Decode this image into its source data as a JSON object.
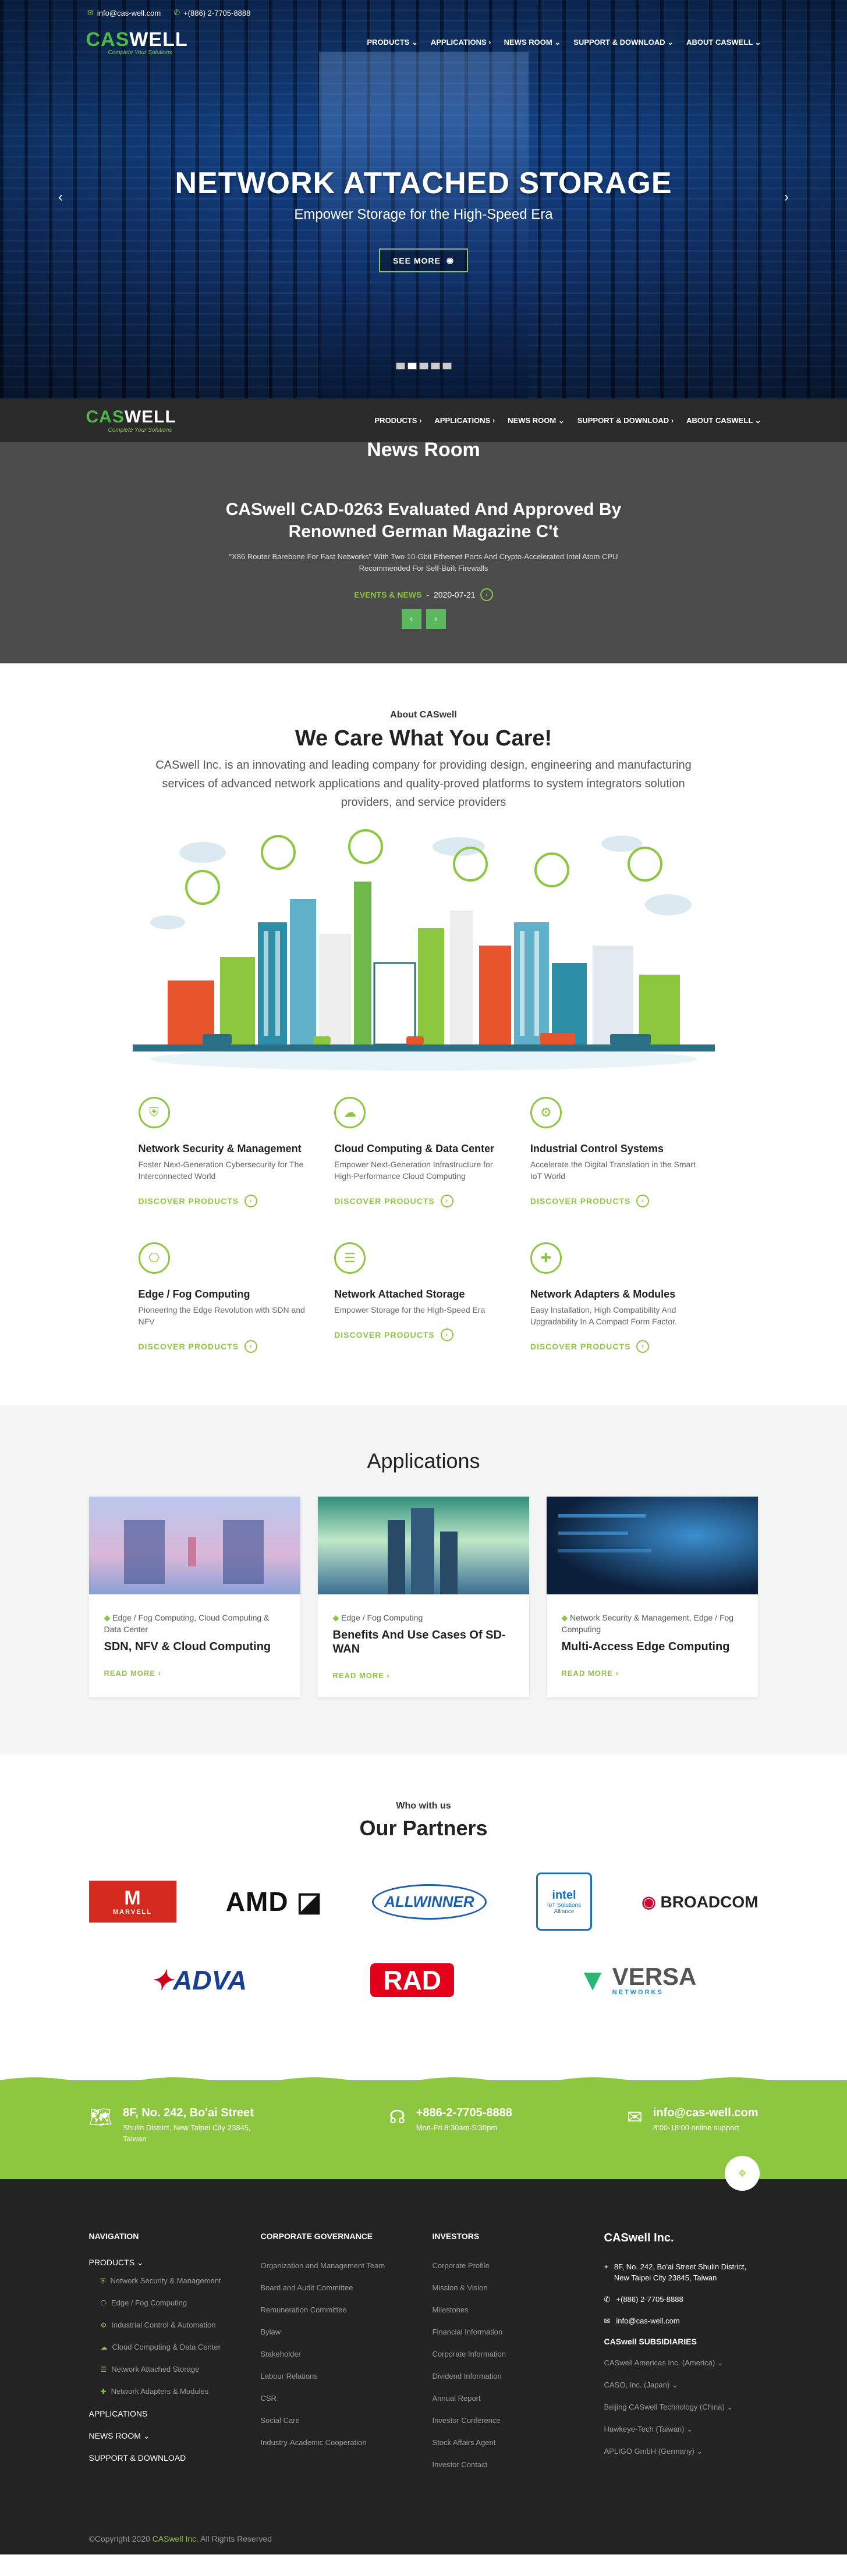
{
  "topbar": {
    "email": "info@cas-well.com",
    "phone": "+(886) 2-7705-8888"
  },
  "logo": {
    "text_a": "CAS",
    "text_b": "WELL",
    "slogan": "Complete Your Solutions"
  },
  "menu": [
    "PRODUCTS ⌄",
    "APPLICATIONS ›",
    "NEWS ROOM ⌄",
    "SUPPORT & DOWNLOAD ⌄",
    "ABOUT CASWELL ⌄"
  ],
  "sticky_menu": [
    "PRODUCTS ›",
    "APPLICATIONS ›",
    "NEWS ROOM ⌄",
    "SUPPORT & DOWNLOAD ›",
    "ABOUT CASWELL ⌄"
  ],
  "hero": {
    "title": "NETWORK ATTACHED STORAGE",
    "subtitle": "Empower Storage for the High-Speed Era",
    "button": "SEE MORE"
  },
  "news": {
    "heading": "News Room",
    "title": "CASwell CAD-0263 Evaluated And Approved By Renowned German Magazine C't",
    "excerpt": "\"X86 Router Barebone For Fast Networks\" With Two 10-Gbit Ethernet Ports And Crypto-Accelerated Intel Atom CPU Recommended For Self-Built Firewalls",
    "category": "EVENTS & NEWS",
    "date": "2020-07-21"
  },
  "about": {
    "small": "About CASwell",
    "title": "We Care What You Care!",
    "desc": "CASwell Inc. is an innovating and leading company for providing design, engineering and manufacturing services of advanced network applications and quality-proved platforms to system integrators solution providers, and service providers"
  },
  "solutions": [
    {
      "title": "Network Security & Management",
      "desc": "Foster Next-Generation Cybersecurity for The Interconnected World",
      "link": "DISCOVER PRODUCTS",
      "icon": "shield-icon"
    },
    {
      "title": "Cloud Computing & Data Center",
      "desc": "Empower Next-Generation Infrastructure for High-Performance Cloud Computing",
      "link": "DISCOVER PRODUCTS",
      "icon": "cloud-icon"
    },
    {
      "title": "Industrial Control Systems",
      "desc": "Accelerate the Digital Translation in the Smart IoT World",
      "link": "DISCOVER PRODUCTS",
      "icon": "gear-icon"
    },
    {
      "title": "Edge / Fog Computing",
      "desc": "Pioneering the Edge Revolution with SDN and NFV",
      "link": "DISCOVER PRODUCTS",
      "icon": "network-icon"
    },
    {
      "title": "Network Attached Storage",
      "desc": "Empower Storage for the High-Speed Era",
      "link": "DISCOVER PRODUCTS",
      "icon": "database-icon"
    },
    {
      "title": "Network Adapters & Modules",
      "desc": "Easy Installation, High Compatibility And Upgradability In A Compact Form Factor.",
      "link": "DISCOVER PRODUCTS",
      "icon": "puzzle-icon"
    }
  ],
  "applications": {
    "title": "Applications",
    "cards": [
      {
        "tag": "Edge / Fog Computing, Cloud Computing & Data Center",
        "title": "SDN, NFV & Cloud Computing",
        "more": "READ MORE ›"
      },
      {
        "tag": "Edge / Fog Computing",
        "title": "Benefits And Use Cases Of SD-WAN",
        "more": "READ MORE ›"
      },
      {
        "tag": "Network Security & Management, Edge / Fog Computing",
        "title": "Multi-Access Edge Computing",
        "more": "READ MORE ›"
      }
    ]
  },
  "partners": {
    "small": "Who with us",
    "title": "Our Partners",
    "row1": [
      "MARVELL",
      "AMD",
      "ALLWINNER",
      "IoT Solutions Alliance",
      "BROADCOM"
    ],
    "row2": [
      "ADVA",
      "RAD",
      "VERSA"
    ],
    "intel": "intel",
    "versa_sub": "NETWORKS"
  },
  "contact": {
    "address_t1": "8F, No. 242, Bo'ai Street",
    "address_t2": "Shulin District, New Taipei City 23845, Taiwan",
    "phone_t1": "+886-2-7705-8888",
    "phone_t2": "Mon-Fri 8:30am-5:30pm",
    "email_t1": "info@cas-well.com",
    "email_t2": "8:00-18:00 online support"
  },
  "footer": {
    "nav_h": "NAVIGATION",
    "nav_products": "PRODUCTS ⌄",
    "nav_sub": [
      "Network Security & Management",
      "Edge / Fog Computing",
      "Industrial Control & Automation",
      "Cloud Computing & Data Center",
      "Network Attached Storage",
      "Network Adapters & Modules"
    ],
    "nav_main": [
      "APPLICATIONS",
      "NEWS ROOM ⌄",
      "SUPPORT & DOWNLOAD"
    ],
    "gov_h": "CORPORATE GOVERNANCE",
    "gov": [
      "Organization and Management Team",
      "Board and Audit Committee",
      "Remuneration Committee",
      "Bylaw",
      "Stakeholder",
      "Labour Relations",
      "CSR",
      "Social Care",
      "Industry-Academic Cooperation"
    ],
    "inv_h": "INVESTORS",
    "inv": [
      "Corporate Profile",
      "Mission & Vision",
      "Milestones",
      "Financial Information",
      "Corporate Information",
      "Dividend Information",
      "Annual Report",
      "Investor Conference",
      "Stock Affairs Agent",
      "Investor Contact"
    ],
    "company": "CASwell Inc.",
    "c_address": "8F, No. 242, Bo'ai Street Shulin District, New Taipei City 23845, Taiwan",
    "c_phone": "+(886) 2-7705-8888",
    "c_email": "info@cas-well.com",
    "subs_h": "CASwell SUBSIDIARIES",
    "subs": [
      "CASwell Americas Inc. (America) ⌄",
      "CASO, Inc. (Japan) ⌄",
      "Beijing CASwell Technology (China) ⌄",
      "Hawkeye-Tech (Taiwan) ⌄",
      "APLIGO GmbH (Germany) ⌄"
    ],
    "copy_a": "©Copyright 2020 ",
    "copy_b": "CASwell Inc.",
    "copy_c": " All Rights Reserved"
  },
  "colors": {
    "accent": "#8dc63f",
    "dark": "#232323",
    "news_bg": "#4b4b4b"
  }
}
